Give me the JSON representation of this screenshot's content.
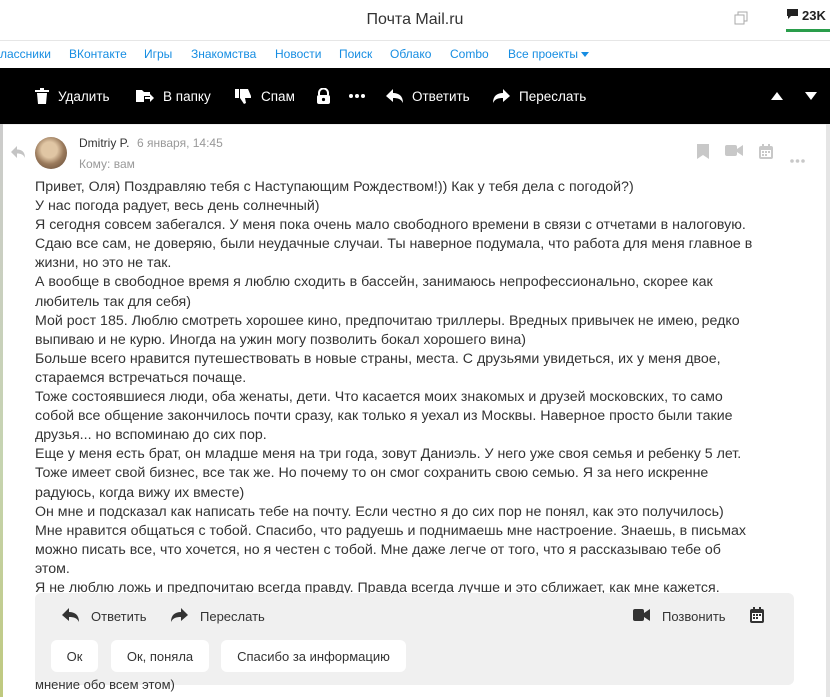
{
  "window": {
    "title": "Почта Mail.ru",
    "notification_count": "23K"
  },
  "portal_nav": {
    "items": [
      "лассники",
      "ВКонтакте",
      "Игры",
      "Знакомства",
      "Новости",
      "Поиск",
      "Облако",
      "Combo",
      "Все проекты"
    ]
  },
  "toolbar": {
    "delete": "Удалить",
    "move": "В папку",
    "spam": "Спам",
    "reply": "Ответить",
    "forward": "Переслать"
  },
  "message": {
    "sender": "Dmitriy P.",
    "date": "6 января, 14:45",
    "to": "Кому: вам",
    "body_lines": [
      "Привет, Оля) Поздравляю тебя с Наступающим Рождеством!)) Как у тебя дела с погодой?)",
      "У нас погода радует, весь день солнечный)",
      "Я сегодня совсем забегался. У меня пока очень мало свободного времени в связи с отчетами в налоговую.",
      "Сдаю все сам, не доверяю, были неудачные случаи. Ты наверное подумала, что работа для меня главное в",
      "жизни, но это не так.",
      "А вообще в свободное время я люблю сходить в бассейн, занимаюсь непрофессионально, скорее как",
      "любитель так для себя)",
      "Мой рост 185. Люблю смотреть хорошее кино, предпочитаю триллеры. Вредных привычек не имею, редко",
      "выпиваю и не курю. Иногда на ужин могу позволить бокал хорошего вина)",
      "Больше всего нравится путешествовать в новые страны, места. С друзьями увидеться, их у меня двое,",
      "стараемся встречаться почаще.",
      "Тоже состоявшиеся люди, оба женаты, дети. Что касается моих знакомых и друзей московских, то само",
      "собой все общение закончилось почти сразу, как только я уехал из Москвы. Наверное просто были такие",
      "друзья... но вспоминаю до сих пор.",
      "Еще у меня есть брат, он младше меня на три года, зовут Даниэль. У него уже своя семья и ребенку 5 лет.",
      "Тоже имеет свой бизнес, все так же. Но почему то он смог сохранить свою семью. Я за него искренне",
      "радуюсь, когда вижу их вместе)",
      "Он мне и подсказал как написать тебе на почту. Если честно я до сих пор не понял, как это получилось)",
      "Мне нравится общаться с тобой. Спасибо, что радуешь и поднимаешь мне настроение. Знаешь, в письмах",
      "можно писать все, что хочется, но я честен с тобой. Мне даже легче от того, что я рассказываю тебе об",
      "этом.",
      "Я не люблю ложь и предпочитаю всегда правду. Правда всегда лучше и это сближает, как мне кажется."
    ],
    "last_line": "мнение обо всем этом)"
  },
  "reply_bar": {
    "reply": "Ответить",
    "forward": "Переслать",
    "call": "Позвонить",
    "quick_replies": [
      "Ок",
      "Ок, поняла",
      "Спасибо за информацию"
    ]
  }
}
